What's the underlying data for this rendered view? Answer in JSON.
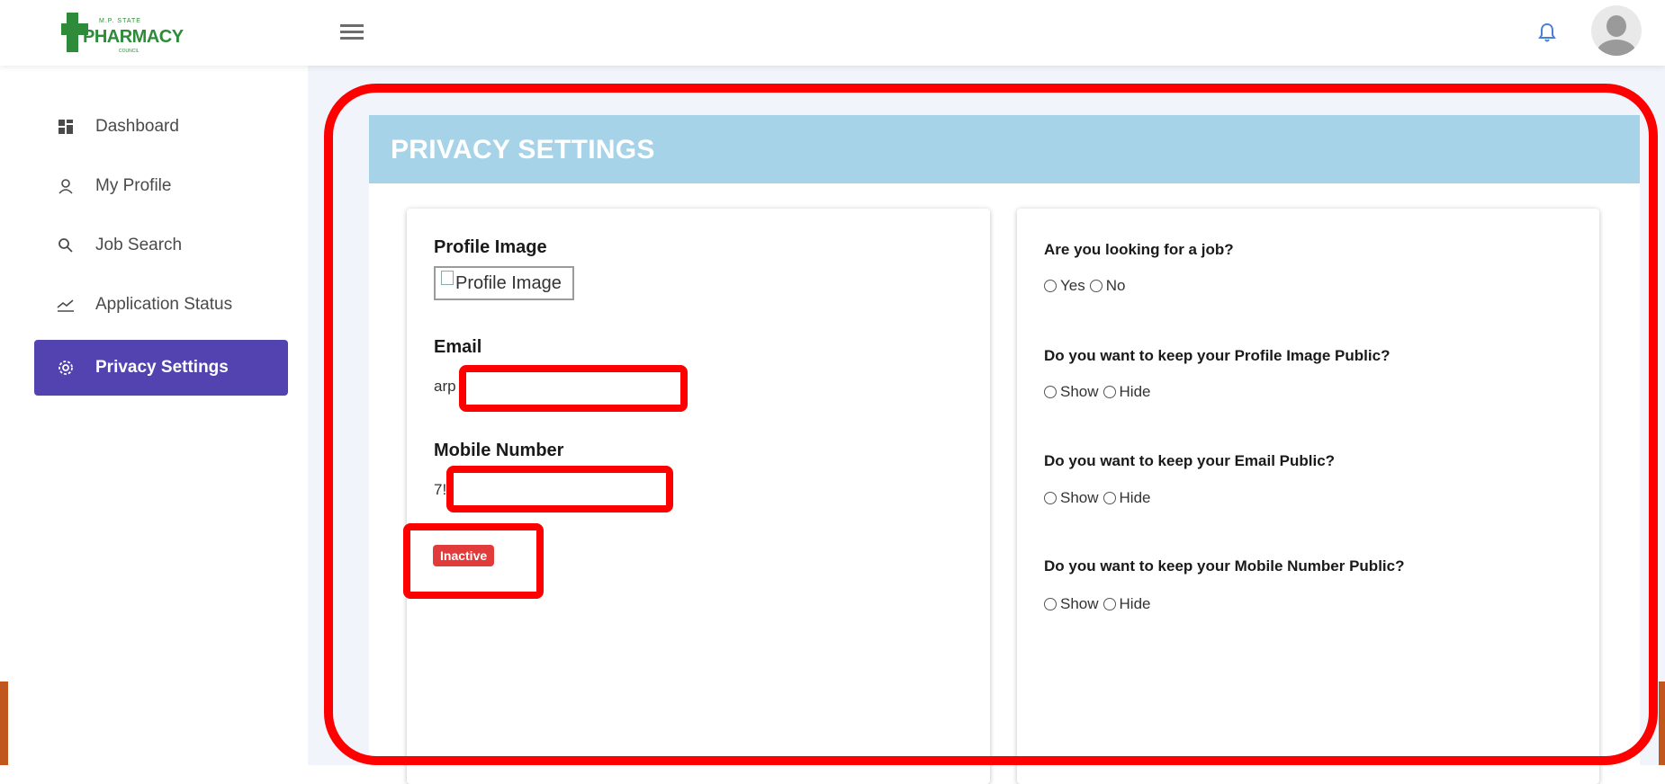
{
  "header": {
    "logo": {
      "top_text": "M.P. STATE",
      "main_text": "PHARMACY",
      "bottom_text": "COUNCIL"
    },
    "icons": {
      "menu": "hamburger-menu-icon",
      "notifications": "bell-icon",
      "profile": "avatar-icon"
    }
  },
  "sidebar": {
    "items": [
      {
        "label": "Dashboard",
        "icon": "dashboard-icon"
      },
      {
        "label": "My Profile",
        "icon": "user-icon"
      },
      {
        "label": "Job Search",
        "icon": "search-icon"
      },
      {
        "label": "Application Status",
        "icon": "chart-trend-icon"
      },
      {
        "label": "Privacy Settings",
        "icon": "gear-icon",
        "active": true
      }
    ]
  },
  "page": {
    "title": "PRIVACY SETTINGS",
    "profile": {
      "image_label": "Profile Image",
      "image_alt": "Profile Image",
      "email_label": "Email",
      "email_value_visible": "arp",
      "mobile_label": "Mobile Number",
      "mobile_value_visible": "7!",
      "status_badge": "Inactive"
    },
    "settings": [
      {
        "question": "Are you looking for a job?",
        "options": [
          "Yes",
          "No"
        ]
      },
      {
        "question": "Do you want to keep your Profile Image Public?",
        "options": [
          "Show",
          "Hide"
        ]
      },
      {
        "question": "Do you want to keep your Email Public?",
        "options": [
          "Show",
          "Hide"
        ]
      },
      {
        "question": "Do you want to keep your Mobile Number Public?",
        "options": [
          "Show",
          "Hide"
        ]
      }
    ]
  },
  "colors": {
    "sidebar_active": "#5243b0",
    "panel_header": "#a6d3e8",
    "badge_inactive": "#e23b3b",
    "annotation_red": "#ff0000"
  }
}
